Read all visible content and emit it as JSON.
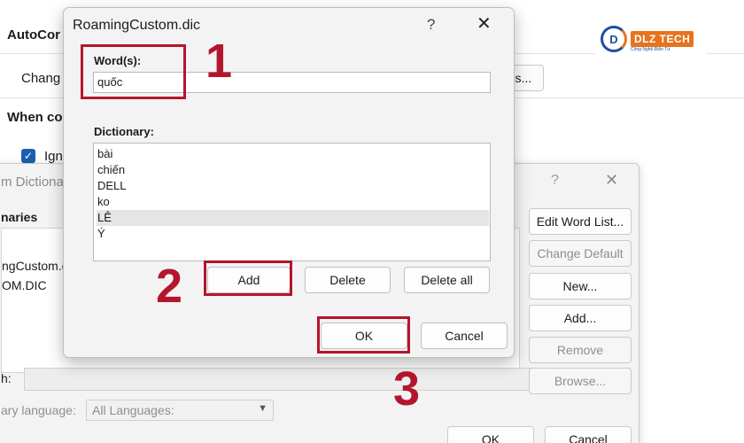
{
  "background": {
    "autocorrect_heading": "AutoCor",
    "change_label": "Chang",
    "ns_button": "ns...",
    "when_heading": "When co",
    "ignore_label": "Ign",
    "ignore_checked": true,
    "logo": {
      "mark": "D",
      "text": "DLZ TECH",
      "sub": "Công Nghệ Điện Tử"
    }
  },
  "custom_dictionaries_dialog": {
    "title": "m Dictiona",
    "help": "?",
    "close": "✕",
    "list_header": "naries",
    "list_items": [
      "ngCustom.d",
      "OM.DIC"
    ],
    "buttons": {
      "edit_word_list": "Edit Word List...",
      "change_default": "Change Default",
      "new": "New...",
      "add": "Add...",
      "remove": "Remove",
      "browse": "Browse..."
    },
    "path_label": "h:",
    "language_label": "ary language:",
    "language_value": "All Languages:",
    "ok": "OK",
    "cancel": "Cancel"
  },
  "roaming_dialog": {
    "title": "RoamingCustom.dic",
    "help": "?",
    "close": "✕",
    "words_label": "Word(s):",
    "word_input_value": "quốc",
    "dictionary_label": "Dictionary:",
    "dictionary_items": [
      "bài",
      "chiến",
      "DELL",
      "ko",
      "LÊ",
      "Ý"
    ],
    "selected_index": 4,
    "buttons": {
      "add": "Add",
      "delete": "Delete",
      "delete_all": "Delete all",
      "ok": "OK",
      "cancel": "Cancel"
    }
  },
  "annotations": {
    "step1": "1",
    "step2": "2",
    "step3": "3"
  },
  "colors": {
    "annotation_red": "#b3162c",
    "checkbox_blue": "#1a5fb4"
  }
}
